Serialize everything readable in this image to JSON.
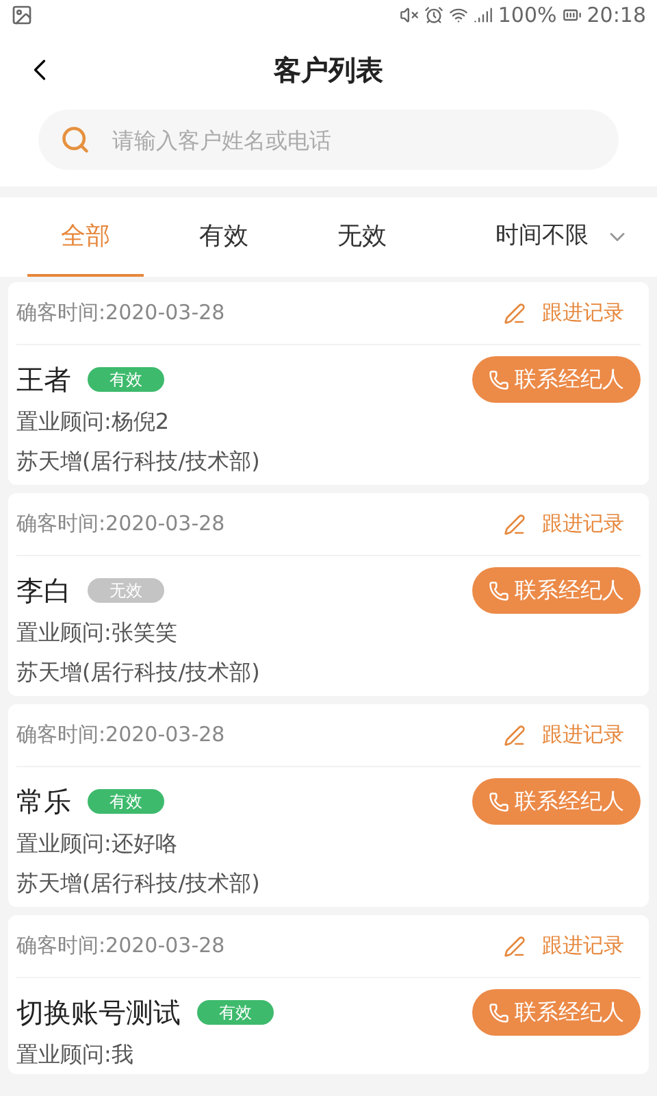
{
  "status_bar": {
    "battery": "100%",
    "time": "20:18"
  },
  "header": {
    "title": "客户列表"
  },
  "search": {
    "placeholder": "请输入客户姓名或电话"
  },
  "tabs": [
    {
      "label": "全部",
      "selected": true
    },
    {
      "label": "有效",
      "selected": false
    },
    {
      "label": "无效",
      "selected": false
    }
  ],
  "time_filter": {
    "label": "时间不限"
  },
  "customers": [
    {
      "confirm_time": "确客时间:2020-03-28",
      "follow_label": "跟进记录",
      "name": "王者",
      "status": "有效",
      "valid": true,
      "consultant": "置业顾问:杨倪2",
      "company": "苏天增(居行科技/技术部)",
      "contact_label": "联系经纪人"
    },
    {
      "confirm_time": "确客时间:2020-03-28",
      "follow_label": "跟进记录",
      "name": "李白",
      "status": "无效",
      "valid": false,
      "consultant": "置业顾问:张笑笑",
      "company": "苏天增(居行科技/技术部)",
      "contact_label": "联系经纪人"
    },
    {
      "confirm_time": "确客时间:2020-03-28",
      "follow_label": "跟进记录",
      "name": "常乐",
      "status": "有效",
      "valid": true,
      "consultant": "置业顾问:还好咯",
      "company": "苏天增(居行科技/技术部)",
      "contact_label": "联系经纪人"
    },
    {
      "confirm_time": "确客时间:2020-03-28",
      "follow_label": "跟进记录",
      "name": "切换账号测试",
      "status": "有效",
      "valid": true,
      "consultant": "置业顾问:我",
      "contact_label": "联系经纪人"
    }
  ]
}
